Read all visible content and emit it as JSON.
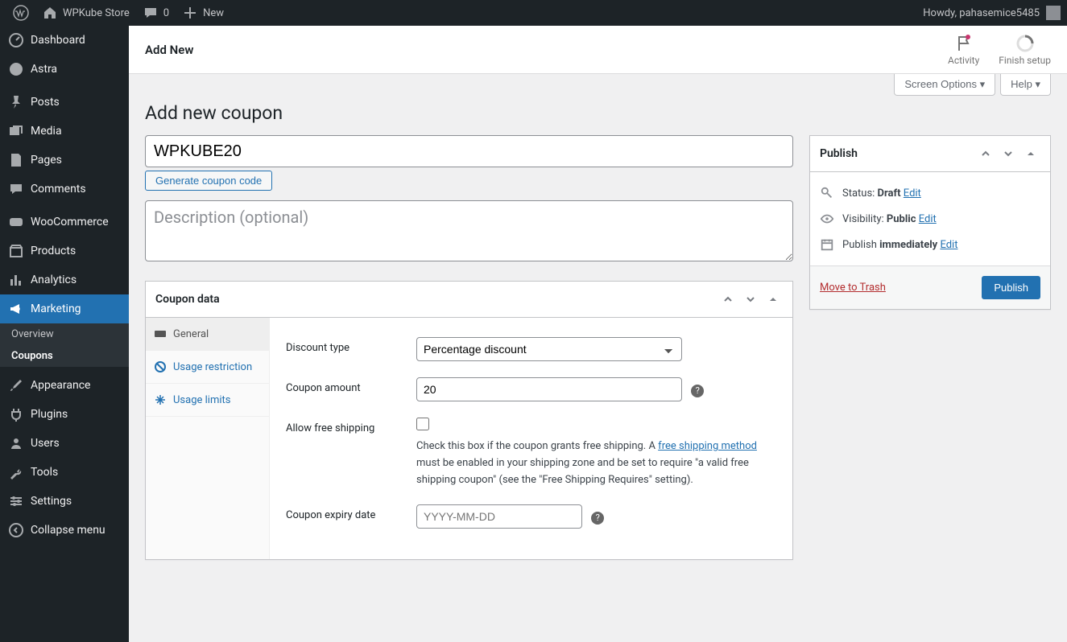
{
  "adminbar": {
    "site_name": "WPKube Store",
    "comments_count": "0",
    "new_label": "New",
    "howdy": "Howdy, pahasemice5485"
  },
  "menu": {
    "dashboard": "Dashboard",
    "astra": "Astra",
    "posts": "Posts",
    "media": "Media",
    "pages": "Pages",
    "comments": "Comments",
    "woocommerce": "WooCommerce",
    "products": "Products",
    "analytics": "Analytics",
    "marketing": "Marketing",
    "appearance": "Appearance",
    "plugins": "Plugins",
    "users": "Users",
    "tools": "Tools",
    "settings": "Settings",
    "collapse": "Collapse menu",
    "submenu": {
      "overview": "Overview",
      "coupons": "Coupons"
    }
  },
  "header": {
    "title": "Add New",
    "activity": "Activity",
    "finish_setup": "Finish setup"
  },
  "screen_meta": {
    "options": "Screen Options",
    "help": "Help"
  },
  "page": {
    "heading": "Add new coupon"
  },
  "coupon": {
    "code_value": "WPKUBE20",
    "generate_label": "Generate coupon code",
    "desc_placeholder": "Description (optional)"
  },
  "coupon_data": {
    "box_title": "Coupon data",
    "tabs": {
      "general": "General",
      "usage_restriction": "Usage restriction",
      "usage_limits": "Usage limits"
    },
    "fields": {
      "discount_type_label": "Discount type",
      "discount_type_value": "Percentage discount",
      "amount_label": "Coupon amount",
      "amount_value": "20",
      "free_shipping_label": "Allow free shipping",
      "free_shipping_help_pre": "Check this box if the coupon grants free shipping. A ",
      "free_shipping_link": "free shipping method",
      "free_shipping_help_post": " must be enabled in your shipping zone and be set to require \"a valid free shipping coupon\" (see the \"Free Shipping Requires\" setting).",
      "expiry_label": "Coupon expiry date",
      "expiry_placeholder": "YYYY-MM-DD"
    }
  },
  "publish": {
    "box_title": "Publish",
    "status_label": "Status: ",
    "status_value": "Draft",
    "visibility_label": "Visibility: ",
    "visibility_value": "Public",
    "schedule_label": "Publish ",
    "schedule_value": "immediately",
    "edit": "Edit",
    "trash": "Move to Trash",
    "publish_btn": "Publish"
  }
}
